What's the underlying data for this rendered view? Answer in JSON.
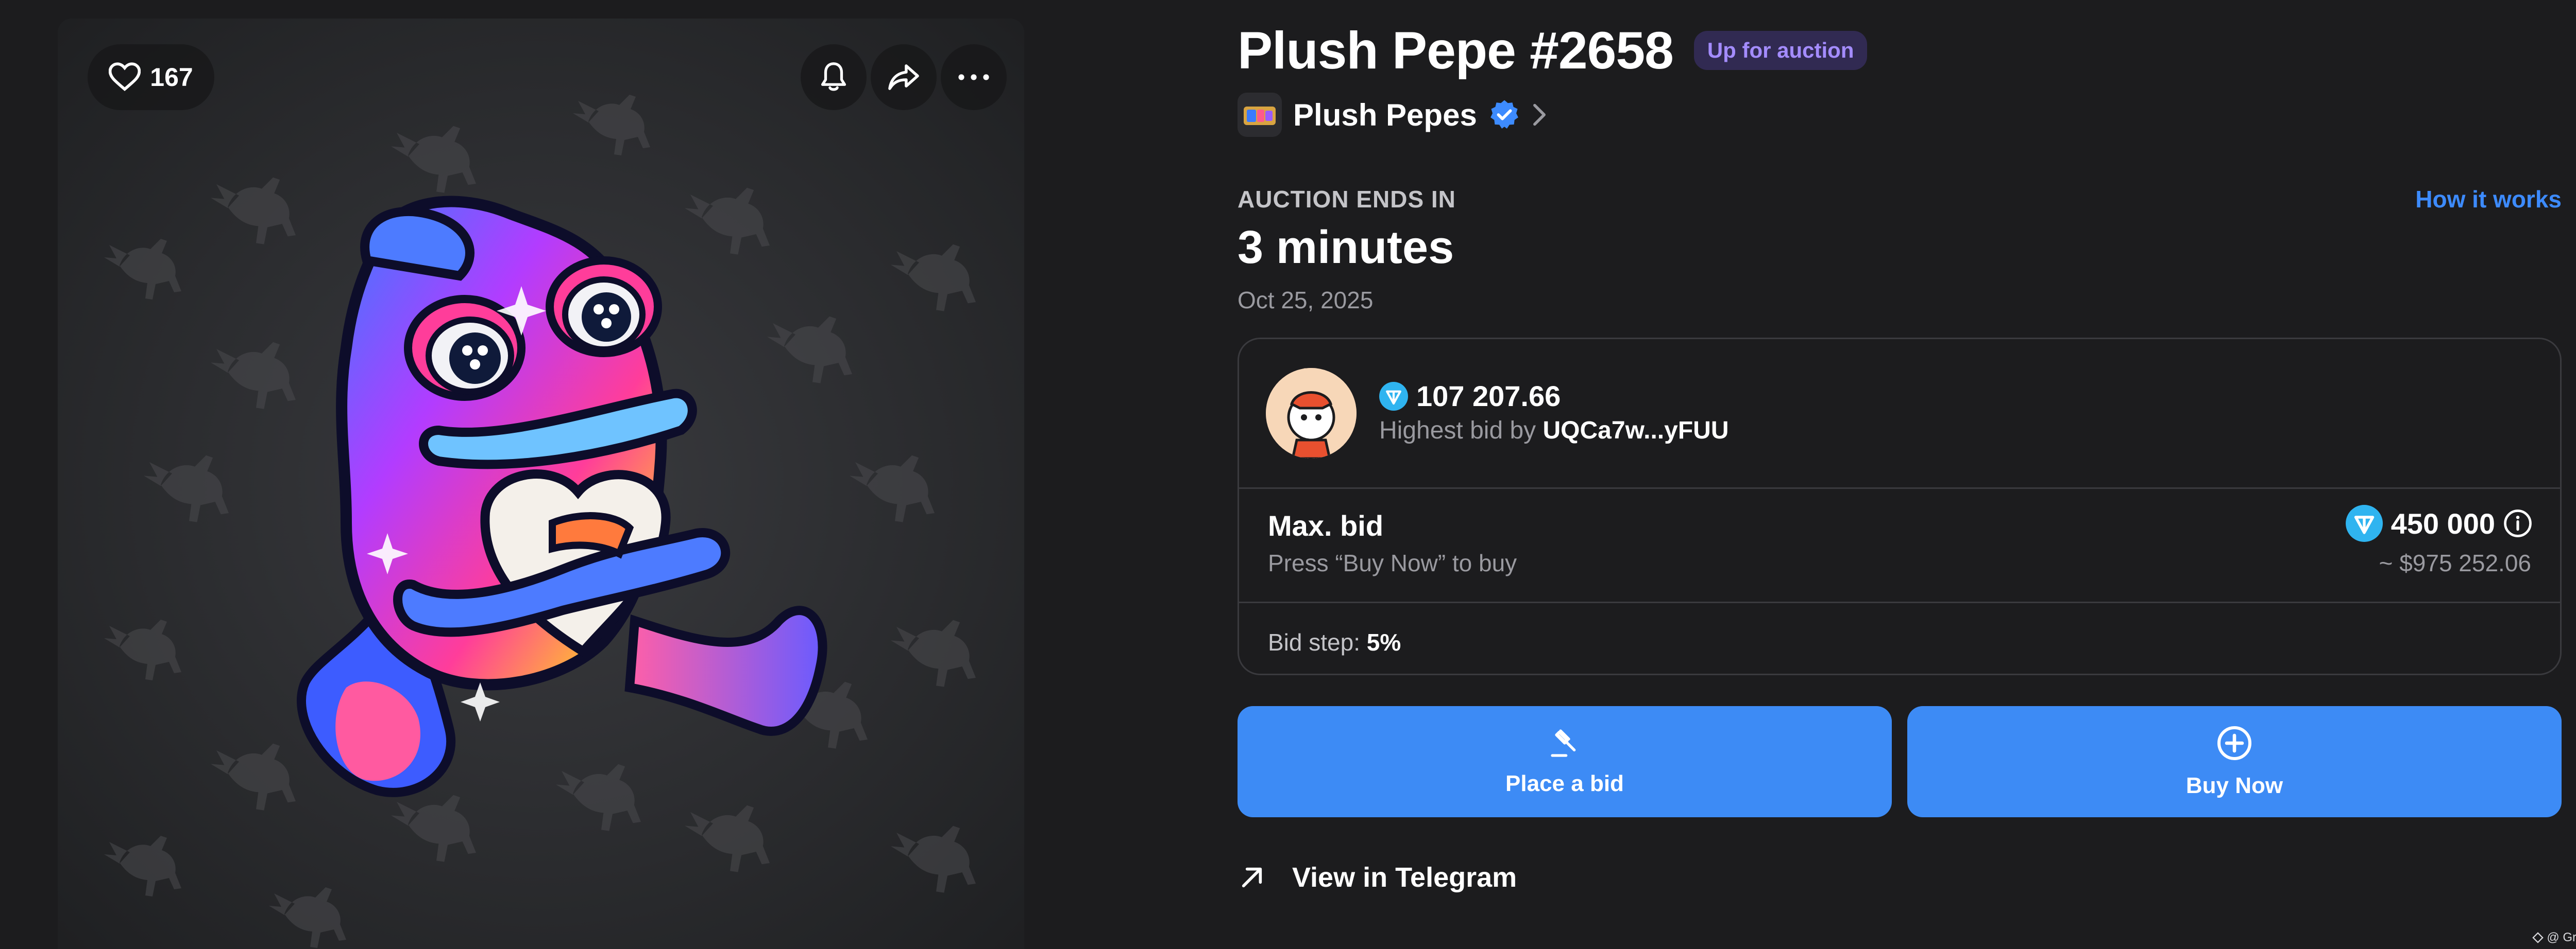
{
  "media": {
    "likes": "167",
    "icons": {
      "like": "heart-icon",
      "bell": "bell-icon",
      "share": "share-icon",
      "more": "more-icon"
    }
  },
  "item": {
    "title": "Plush Pepe #2658",
    "status_badge": "Up for auction",
    "collection": "Plush Pepes"
  },
  "auction": {
    "ends_label": "AUCTION ENDS IN",
    "how_it_works": "How it works",
    "ends_value": "3 minutes",
    "ends_date": "Oct 25, 2025"
  },
  "bid_card": {
    "highest_amount": "107 207.66",
    "highest_by_prefix": "Highest bid by",
    "highest_by_address": "UQCa7w...yFUU",
    "max_label": "Max. bid",
    "max_note": "Press “Buy Now” to buy",
    "max_value": "450 000",
    "max_usd": "~ $975 252.06",
    "step_label": "Bid step:",
    "step_value": "5%"
  },
  "actions": {
    "place_bid": "Place a bid",
    "buy_now": "Buy Now",
    "view_telegram": "View in Telegram"
  },
  "watermark": "@ Great Buffett",
  "colors": {
    "background": "#1c1c1e",
    "accent_blue": "#3d8bf5",
    "link_blue": "#3d8bff",
    "badge_purple": "#a48cff",
    "ton_blue": "#2fb4f0"
  }
}
